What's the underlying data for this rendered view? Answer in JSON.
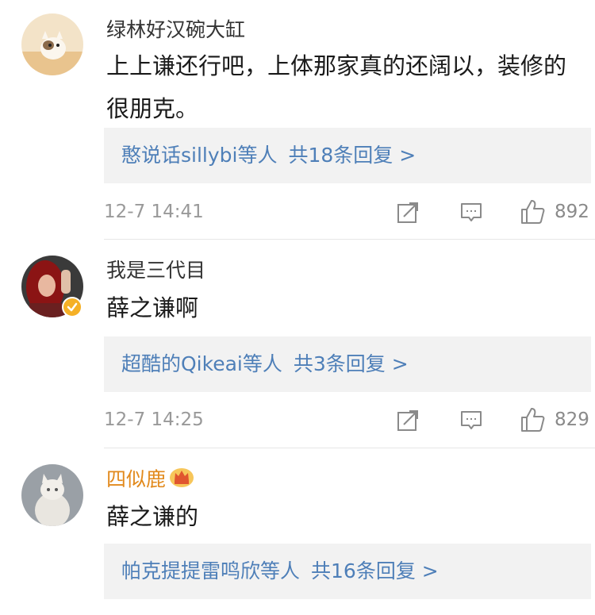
{
  "colors": {
    "link_blue": "#4e7fb8",
    "gold_name": "#e28a1d",
    "meta_gray": "#999999",
    "reply_bg": "#f2f2f2"
  },
  "comments": [
    {
      "username": "绿林好汉碗大缸",
      "text": "上上谦还行吧，上体那家真的还阔以，装修的很朋克。",
      "reply_users": "憨说话sillybi等人",
      "reply_total": "共18条回复 >",
      "timestamp": "12-7 14:41",
      "likes": "892",
      "icons": [
        "share-icon",
        "comment-icon",
        "like-icon"
      ]
    },
    {
      "username": "我是三代目",
      "verified": true,
      "text": "薛之谦啊",
      "reply_users": "超酷的Qikeai等人",
      "reply_total": "共3条回复 >",
      "timestamp": "12-7 14:25",
      "likes": "829",
      "icons": [
        "share-icon",
        "comment-icon",
        "like-icon"
      ]
    },
    {
      "username": "四似鹿",
      "vip_crown": true,
      "text": "薛之谦的",
      "reply_users": "帕克提提雷鸣欣等人",
      "reply_total": "共16条回复 >"
    }
  ]
}
